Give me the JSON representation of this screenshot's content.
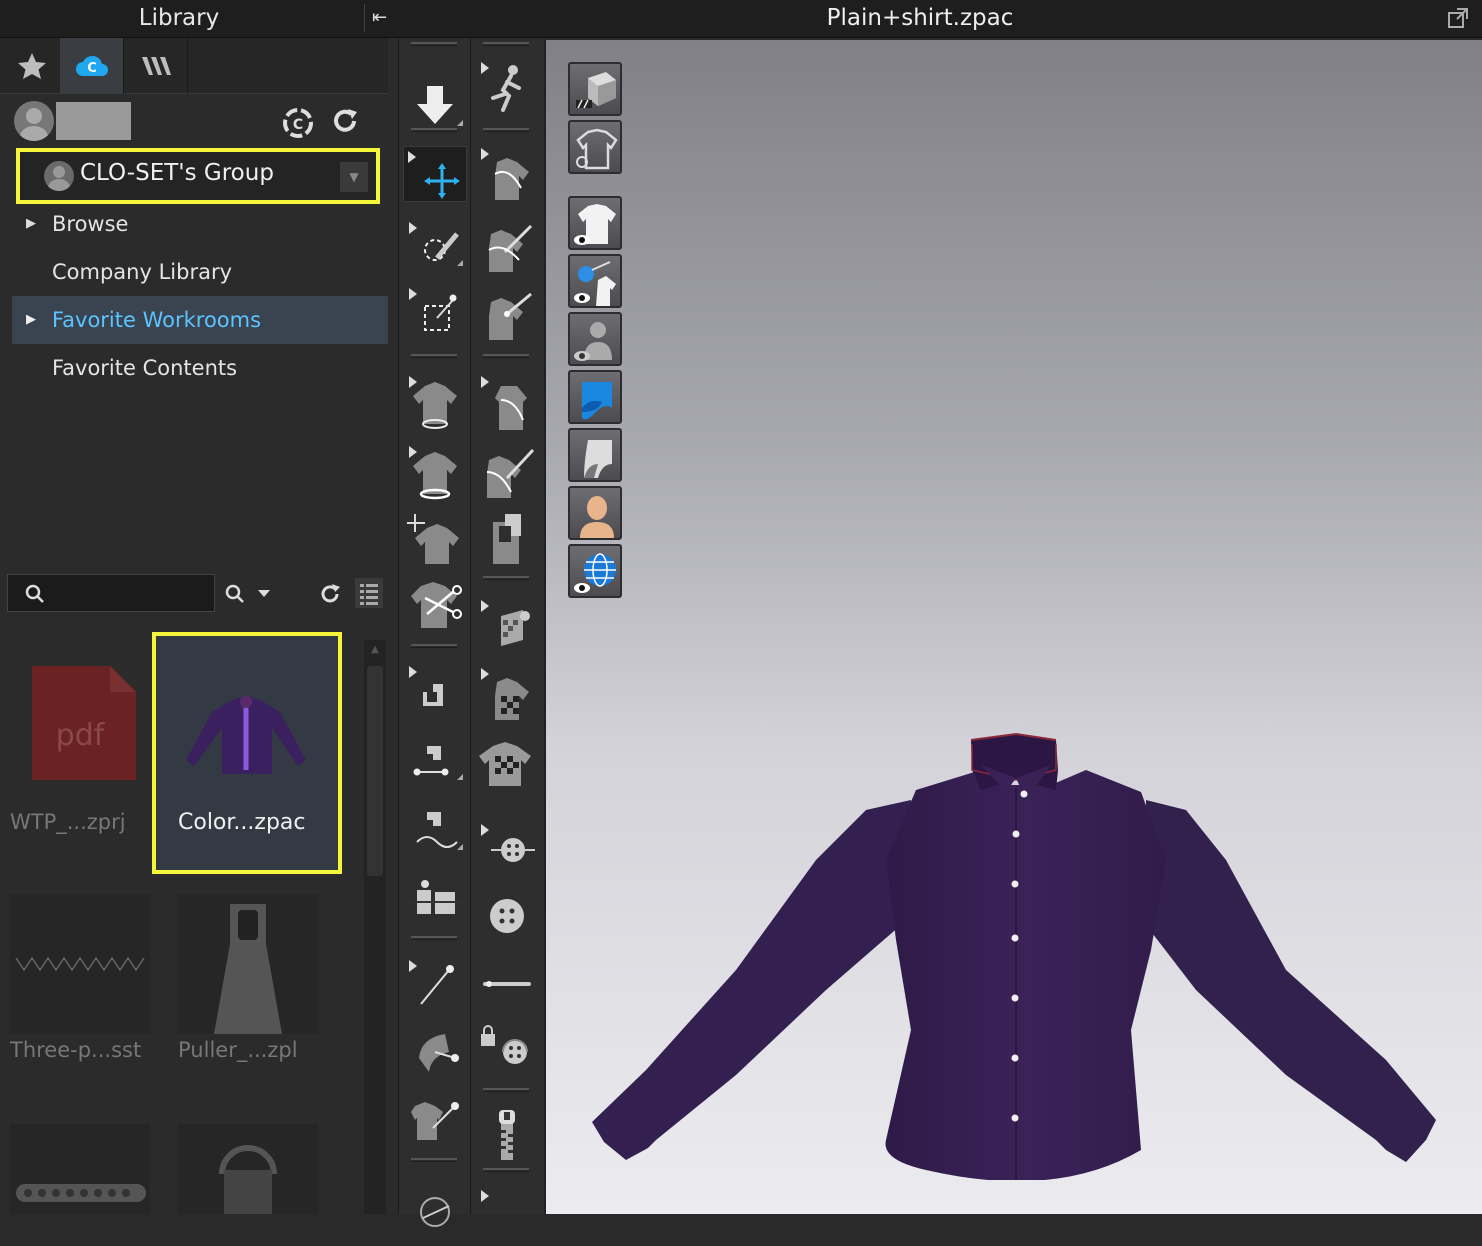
{
  "library": {
    "title": "Library",
    "tabs": [
      {
        "icon": "star-icon"
      },
      {
        "icon": "clo-set-cloud-icon",
        "active": true
      },
      {
        "icon": "workroom-w-icon"
      }
    ],
    "group_label": "CLO-SET's Group",
    "nav": [
      {
        "label": "Browse",
        "expandable": true
      },
      {
        "label": "Company Library",
        "expandable": false
      },
      {
        "label": "Favorite Workrooms",
        "expandable": true,
        "selected": true
      },
      {
        "label": "Favorite Contents",
        "expandable": false
      }
    ],
    "search": {
      "value": "",
      "placeholder": ""
    },
    "thumbnails": [
      {
        "caption": "WTP_...zprj",
        "img_text": "pdf"
      },
      {
        "caption": "Color...zpac",
        "highlighted": true
      },
      {
        "caption": "Three-p...sst"
      },
      {
        "caption": "Puller_...zpl"
      },
      {
        "caption": ""
      },
      {
        "caption": ""
      }
    ]
  },
  "viewport": {
    "title": "Plain+shirt.zpac",
    "garment_color": "#3a2256"
  },
  "colors": {
    "highlight": "#f5f53a",
    "accent_blue": "#5cc4ff",
    "panel_bg": "#2b2b2b"
  }
}
